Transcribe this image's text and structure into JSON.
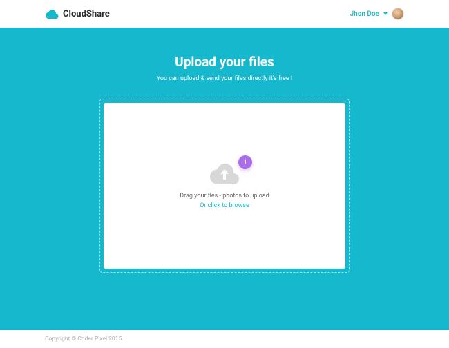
{
  "header": {
    "brand": "CloudShare",
    "user_name": "Jhon Doe"
  },
  "hero": {
    "title": "Upload your files",
    "subtitle": "You can upload & send your files directly it's free !"
  },
  "upload": {
    "badge_count": "1",
    "drag_text": "Drag your fles - photos to upload",
    "browse_text": "Or click to browse"
  },
  "footer": {
    "copyright": "Copyright © Coder Pixel 2015."
  },
  "colors": {
    "primary": "#15b8cc",
    "accent": "#a96ee8"
  }
}
